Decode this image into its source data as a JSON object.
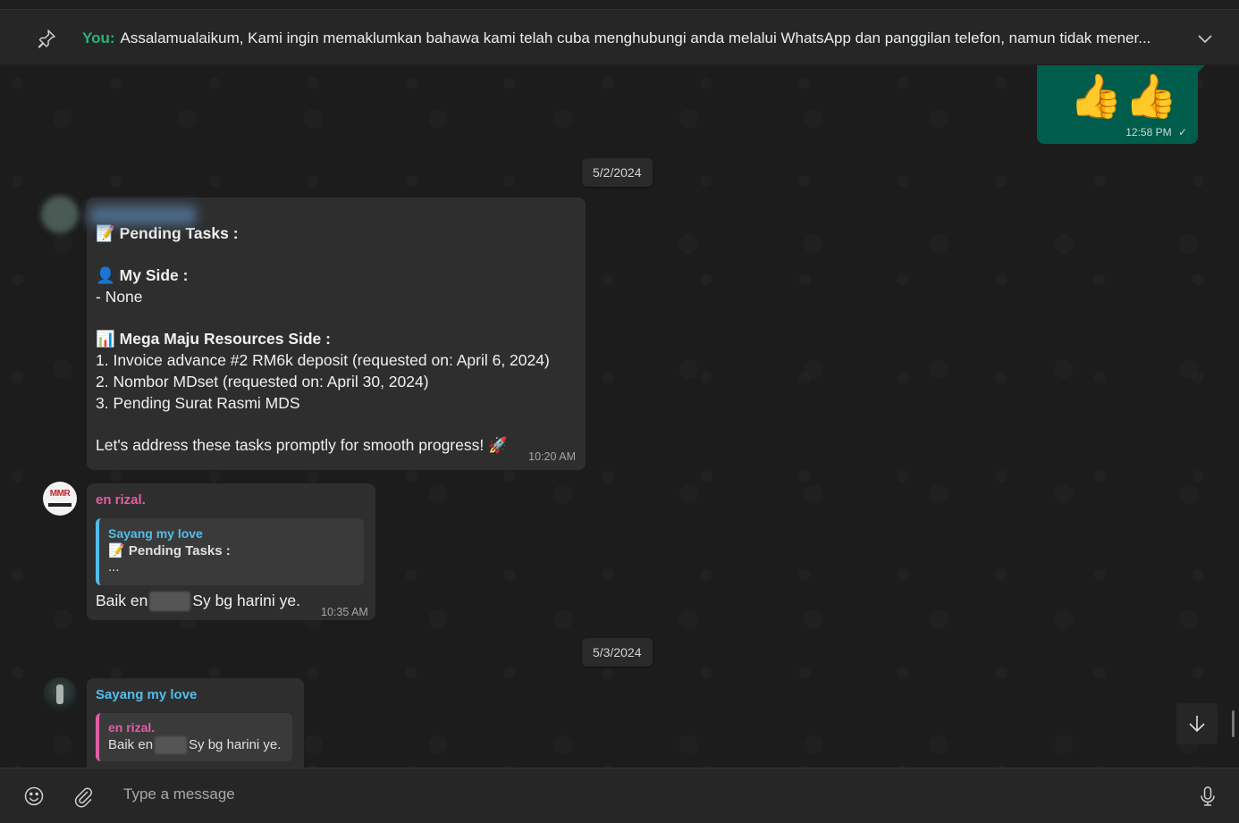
{
  "pinned": {
    "prefix": "You:",
    "text": "Assalamualaikum,  Kami ingin memaklumkan bahawa kami telah cuba menghubungi anda melalui WhatsApp dan panggilan telefon, namun tidak mener..."
  },
  "sent_sticker": {
    "emoji": "👍👍",
    "time": "12:58 PM",
    "status": "✓"
  },
  "dates": [
    "5/2/2024",
    "5/3/2024"
  ],
  "msg1": {
    "title": "📝 Pending Tasks :",
    "my_side_label": "👤 My Side :",
    "my_side_item": "- None",
    "mmr_label": "📊 Mega Maju Resources Side :",
    "items": [
      "1. Invoice advance #2 RM6k deposit (requested on: April 6, 2024)",
      "2. Nombor MDset (requested on: April 30, 2024)",
      "3. Pending Surat Rasmi MDS"
    ],
    "closing": "Let's address these tasks promptly for smooth progress! 🚀",
    "time": "10:20 AM"
  },
  "msg2": {
    "sender": "en rizal.",
    "quote_name": "Sayang my love",
    "quote_line1": "📝 Pending Tasks :",
    "quote_line2": "...",
    "text_before": "Baik en",
    "text_after": "Sy bg harini ye.",
    "time": "10:35 AM",
    "avatar_label": "MMR"
  },
  "msg3": {
    "sender": "Sayang my love",
    "quote_name": "en rizal.",
    "quote_before": "Baik en",
    "quote_after": "Sy bg harini ye."
  },
  "composer": {
    "placeholder": "Type a message"
  },
  "colors": {
    "sent_bubble": "#005c4b",
    "you_label": "#25b676",
    "rizal_name": "#e05fa4",
    "sayang_name": "#53bdeb"
  }
}
